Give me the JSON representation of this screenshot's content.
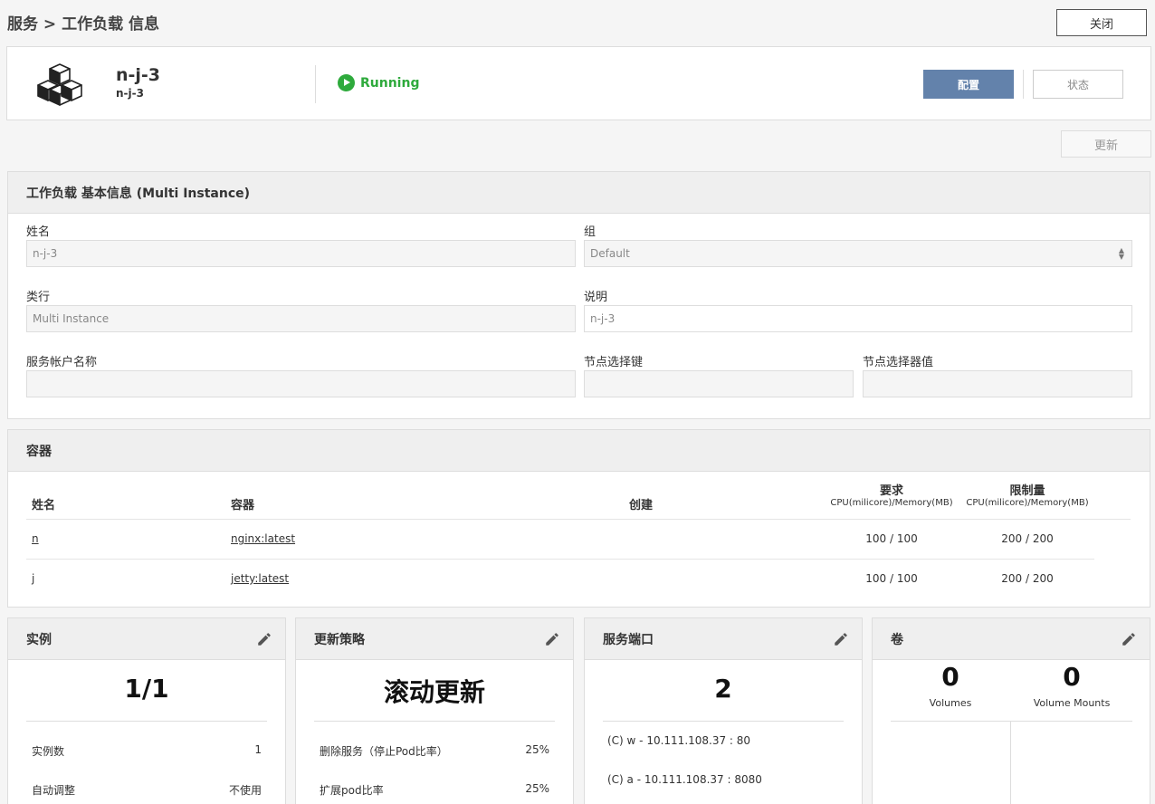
{
  "breadcrumb": "服务 > 工作负载 信息",
  "close_label": "关闭",
  "workload": {
    "name": "n-j-3",
    "subtitle": "n-j-3",
    "status": "Running"
  },
  "actions": {
    "config_label": "配置",
    "status_label": "状态",
    "update_label": "更新"
  },
  "basic": {
    "title": "工作负载 基本信息 (Multi Instance)",
    "name_label": "姓名",
    "name_value": "n-j-3",
    "group_label": "组",
    "group_value": "Default",
    "type_label": "类行",
    "type_value": "Multi Instance",
    "desc_label": "说明",
    "desc_value": "n-j-3",
    "sa_label": "服务帐户名称",
    "sa_value": "",
    "node_key_label": "节点选择键",
    "node_key_value": "",
    "node_val_label": "节点选择器值",
    "node_val_value": ""
  },
  "containers": {
    "title": "容器",
    "headers": {
      "name": "姓名",
      "container": "容器",
      "created": "创建",
      "request": "要求",
      "request_sub": "CPU(milicore)/Memory(MB)",
      "limit": "限制量",
      "limit_sub": "CPU(milicore)/Memory(MB)"
    },
    "rows": [
      {
        "name": "n",
        "image": "nginx:latest",
        "created": "",
        "request": "100 / 100",
        "limit": "200 / 200"
      },
      {
        "name": "j",
        "image": "jetty:latest",
        "created": "",
        "request": "100 / 100",
        "limit": "200 / 200"
      }
    ]
  },
  "instances": {
    "title": "实例",
    "value": "1/1",
    "rows": [
      {
        "k": "实例数",
        "v": "1"
      },
      {
        "k": "自动调整",
        "v": "不使用"
      }
    ]
  },
  "strategy": {
    "title": "更新策略",
    "value": "滚动更新",
    "rows": [
      {
        "k": "删除服务（停止Pod比率）",
        "v": "25%"
      },
      {
        "k": "扩展pod比率",
        "v": "25%"
      }
    ]
  },
  "ports": {
    "title": "服务端口",
    "value": "2",
    "items": [
      "(C) w - 10.111.108.37 : 80",
      "(C) a - 10.111.108.37 : 8080"
    ]
  },
  "volumes": {
    "title": "卷",
    "volumes_count": "0",
    "volumes_label": "Volumes",
    "mounts_count": "0",
    "mounts_label": "Volume Mounts"
  },
  "colors": {
    "accent": "#6382ab",
    "running": "#2eaa3c"
  },
  "icons": [
    "cubes-icon",
    "play-circle-icon",
    "pencil-icon",
    "select-arrows-icon"
  ]
}
